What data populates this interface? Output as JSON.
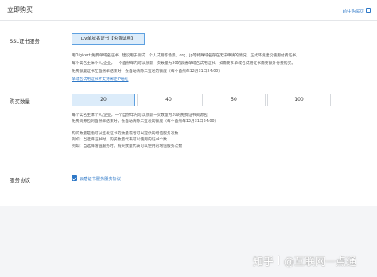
{
  "header": {
    "title": "立即购买",
    "link_label": "前往购买页"
  },
  "ssl": {
    "label": "SSL证书服务",
    "tag": "DV单域名证书【免费试用】",
    "desc": [
      "用Digicert 免费单域名证书，建议用于测试、个人试用等场景，org、jp等特殊域名存在无法申请的情况，正式环境建议使用付费证书。",
      "每个实名主体个人/企业，一个自然年内可以领取一次数量为20的云盾单域名试用证书。如需要多单域名试用证书需要额外付费购买。",
      "免费额度证书在自然年结束时，会自动清除未签发的额度（每个自然年12月31日24:00）"
    ],
    "link": "单域名试用证书不支持绑定IP地址"
  },
  "quantity": {
    "label": "购买数量",
    "options": [
      "20",
      "40",
      "50",
      "100"
    ],
    "selected": "20",
    "desc": [
      "每个实名主体个人/企业，一个自然年内可以领取一次数量为20的免费证书资源包",
      "免费资源包到自然年结束时，会自动清除未签发的额度（每个自然年12月31日24:00）"
    ],
    "notes": [
      "购买数量是指可以签发证书的数量或者可以提供的增值服务次数",
      "例如：当选择证书时，购买数量代表可以使用的证书个数",
      "例如：当选择增值服务时，购买数量代表可以使用的增值服务次数"
    ]
  },
  "agreement": {
    "label": "服务协议",
    "checkbox_label": "云盾证书服务服务协议",
    "checked": true
  },
  "watermark": {
    "logo": "知乎",
    "text": "@互联网一点通"
  }
}
